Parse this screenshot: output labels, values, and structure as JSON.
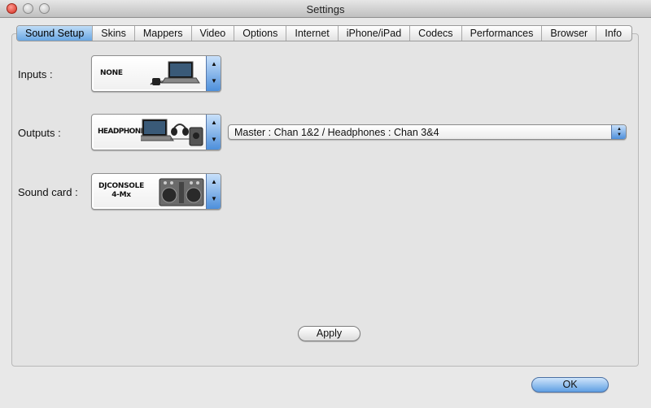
{
  "window": {
    "title": "Settings"
  },
  "tabs": [
    {
      "label": "Sound Setup",
      "active": true
    },
    {
      "label": "Skins"
    },
    {
      "label": "Mappers"
    },
    {
      "label": "Video"
    },
    {
      "label": "Options"
    },
    {
      "label": "Internet"
    },
    {
      "label": "iPhone/iPad"
    },
    {
      "label": "Codecs"
    },
    {
      "label": "Performances"
    },
    {
      "label": "Browser"
    },
    {
      "label": "Info"
    }
  ],
  "inputs": {
    "label": "Inputs :",
    "device": "NONE"
  },
  "outputs": {
    "label": "Outputs :",
    "device": "HEADPHONES",
    "routing": "Master : Chan 1&2 / Headphones : Chan 3&4"
  },
  "soundcard": {
    "label": "Sound card :",
    "device_line1": "DJCONSOLE",
    "device_line2": "4-Mx"
  },
  "buttons": {
    "apply": "Apply",
    "ok": "OK"
  },
  "colors": {
    "accent": "#6aa7e3",
    "close": "#d32a1e"
  }
}
